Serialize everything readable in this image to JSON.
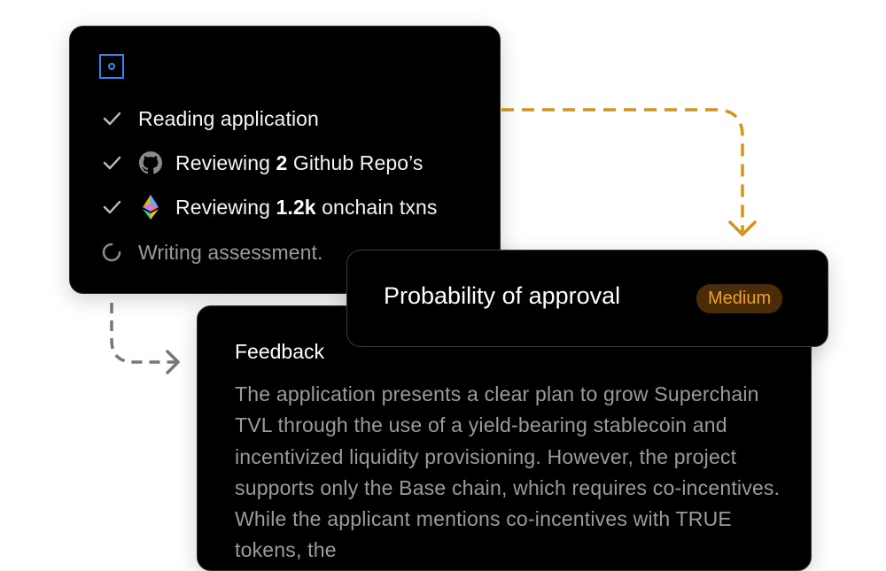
{
  "tasks_card": {
    "logo_icon": "agent-logo-icon",
    "items": [
      {
        "status": "done",
        "parts": {
          "pre": "Reading application",
          "bold": "",
          "post": ""
        },
        "brand": ""
      },
      {
        "status": "done",
        "parts": {
          "pre": "Reviewing ",
          "bold": "2",
          "post": " Github Repo’s"
        },
        "brand": "github-icon"
      },
      {
        "status": "done",
        "parts": {
          "pre": "Reviewing ",
          "bold": "1.2k",
          "post": " onchain txns"
        },
        "brand": "ethereum-icon"
      },
      {
        "status": "in-progress",
        "parts": {
          "pre": "Writing assessment.",
          "bold": "",
          "post": ""
        },
        "brand": ""
      }
    ]
  },
  "approval_card": {
    "label": "Probability of approval",
    "badge": "Medium",
    "badge_color": "#f0a020"
  },
  "feedback_card": {
    "title": "Feedback",
    "body": "The application presents a clear plan to grow Superchain TVL through the use of a yield-bearing stablecoin and incentivized liquidity provisioning. However, the project supports only the Base chain, which requires co-incentives. While the applicant mentions co-incentives with TRUE tokens, the"
  },
  "colors": {
    "accent_blue": "#3b82f6",
    "connector_orange": "#d4941a",
    "connector_gray": "#777777"
  }
}
